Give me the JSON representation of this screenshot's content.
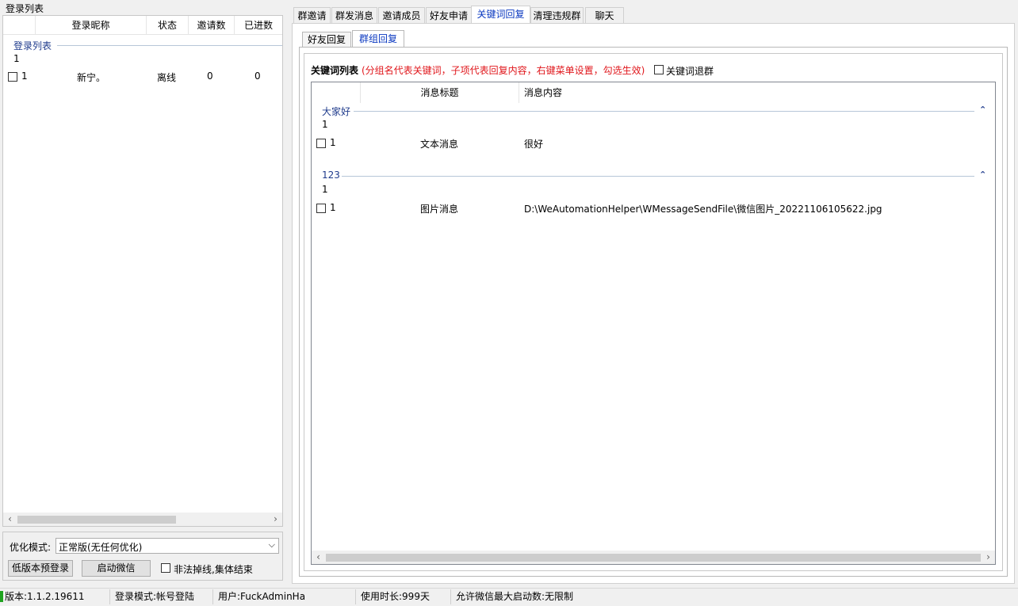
{
  "left_panel": {
    "title": "登录列表",
    "columns": [
      "登录昵称",
      "状态",
      "邀请数",
      "已进数"
    ],
    "group_label": "登录列表",
    "group_count": "1",
    "rows": [
      {
        "index": "1",
        "nickname": "新宁。",
        "status": "离线",
        "invites": "0",
        "joined": "0"
      }
    ]
  },
  "options": {
    "mode_label": "优化模式:",
    "mode_value": "正常版(无任何优化)",
    "low_version_login": "低版本预登录",
    "start_wechat": "启动微信",
    "illegal_drop_label": "非法掉线,集体结束"
  },
  "tabs": [
    "群邀请",
    "群发消息",
    "邀请成员",
    "好友申请",
    "关键词回复",
    "清理违规群",
    "聊天"
  ],
  "active_tab": "关键词回复",
  "subtabs": [
    "好友回复",
    "群组回复"
  ],
  "active_subtab": "群组回复",
  "keyword_section": {
    "title": "关键词列表",
    "hint": "(分组名代表关键词，子项代表回复内容，右键菜单设置，勾选生效)",
    "quit_group_label": "关键词退群",
    "columns": [
      "消息标题",
      "消息内容"
    ],
    "groups": [
      {
        "name": "大家好",
        "count": "1",
        "items": [
          {
            "index": "1",
            "title": "文本消息",
            "content": "很好"
          }
        ]
      },
      {
        "name": "123",
        "count": "1",
        "items": [
          {
            "index": "1",
            "title": "图片消息",
            "content": "D:\\WeAutomationHelper\\WMessageSendFile\\微信图片_20221106105622.jpg"
          }
        ]
      }
    ]
  },
  "status_bar": {
    "version": "版本:1.1.2.19611",
    "login_mode": "登录模式:帐号登陆",
    "user": "用户:FuckAdminHa",
    "usage": "使用时长:999天",
    "max_start": "允许微信最大启动数:无限制"
  },
  "icons": {
    "chevron_up": "chevron-up-icon",
    "scroll_left": "arrow-left-icon",
    "scroll_right": "arrow-right-icon",
    "dropdown": "chevron-down-icon"
  },
  "colors": {
    "accent": "#0a38c0",
    "hint": "#e0161b",
    "group": "#1f3b8c"
  }
}
